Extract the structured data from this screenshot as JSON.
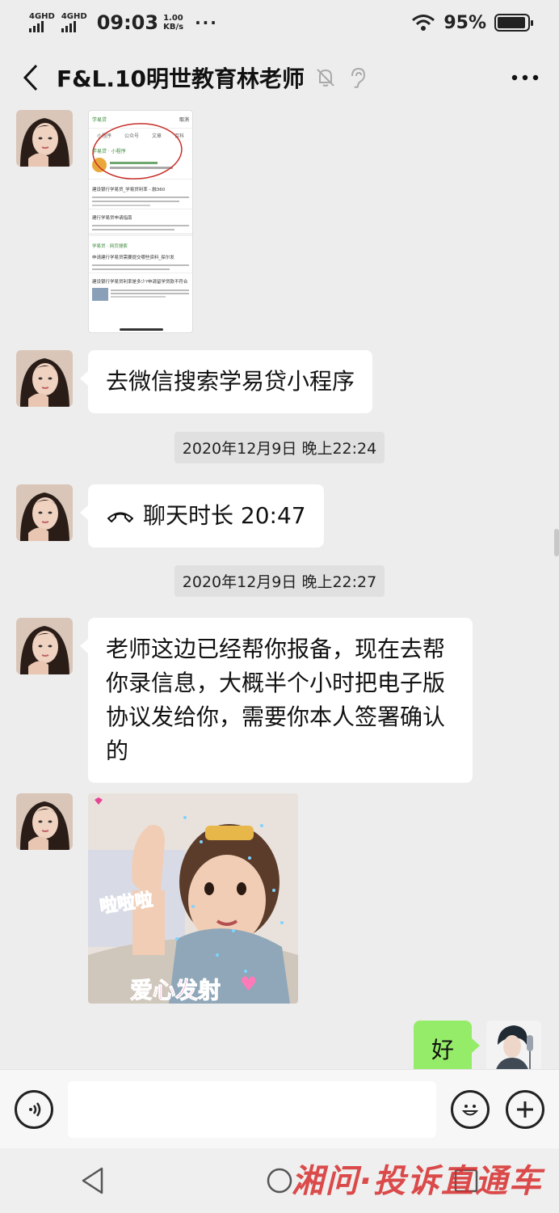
{
  "status_bar": {
    "signal1_label": "4GHD",
    "signal2_label": "4GHD",
    "time": "09:03",
    "speed_value": "1.00",
    "speed_unit": "KB/s",
    "more": "···",
    "battery_percent": "95%",
    "battery_level": 0.95
  },
  "header": {
    "title": "F&L.10明世教育林老师",
    "icons": [
      "back-icon",
      "mute-bell-icon",
      "ear-icon",
      "more-icon"
    ]
  },
  "messages": [
    {
      "type": "image",
      "sender": "other",
      "content": "screenshot"
    },
    {
      "type": "text",
      "sender": "other",
      "text": "去微信搜索学易贷小程序"
    },
    {
      "type": "timestamp",
      "text": "2020年12月9日 晚上22:24"
    },
    {
      "type": "call",
      "sender": "other",
      "text": "聊天时长 20:47"
    },
    {
      "type": "timestamp",
      "text": "2020年12月9日 晚上22:27"
    },
    {
      "type": "text",
      "sender": "other",
      "lines": [
        "老师这边已经帮你报备，现在去帮",
        "你录信息，大概半个小时把电子版",
        "协议发给你，需要你本人签署确认",
        "的"
      ]
    },
    {
      "type": "sticker",
      "sender": "other",
      "text1": "啦啦啦",
      "text2": "爱心发射"
    },
    {
      "type": "text",
      "sender": "me",
      "text": "好"
    }
  ],
  "screenshot_content": {
    "search_query": "学易贷",
    "cancel": "取消",
    "tabs": [
      "小程序",
      "公众号",
      "文章",
      "百科"
    ],
    "section": "学易贷 · 小程序",
    "result1_title": "建设银行学易贷_学易贷利率 - 融360",
    "result2_title": "建行学易贷申请指南",
    "result3_title": "学易贷 · 网页搜索",
    "result4_title": "申请建行学易贷需要提交哪些资料_探尔发",
    "result5_title": "建设银行学易贷利率是多少?申请留学贷款不符合"
  },
  "input_bar": {
    "icons": [
      "voice-icon",
      "emoji-icon",
      "plus-icon"
    ]
  },
  "navbar": {
    "icons": [
      "nav-back-icon",
      "nav-home-icon",
      "nav-recent-icon"
    ]
  },
  "watermark": "湘问·投诉直通车",
  "colors": {
    "background": "#ededed",
    "bubble_other": "#ffffff",
    "bubble_me": "#95ec69",
    "timestamp_bg": "#e0e0e0",
    "watermark": "#d72d2d"
  }
}
